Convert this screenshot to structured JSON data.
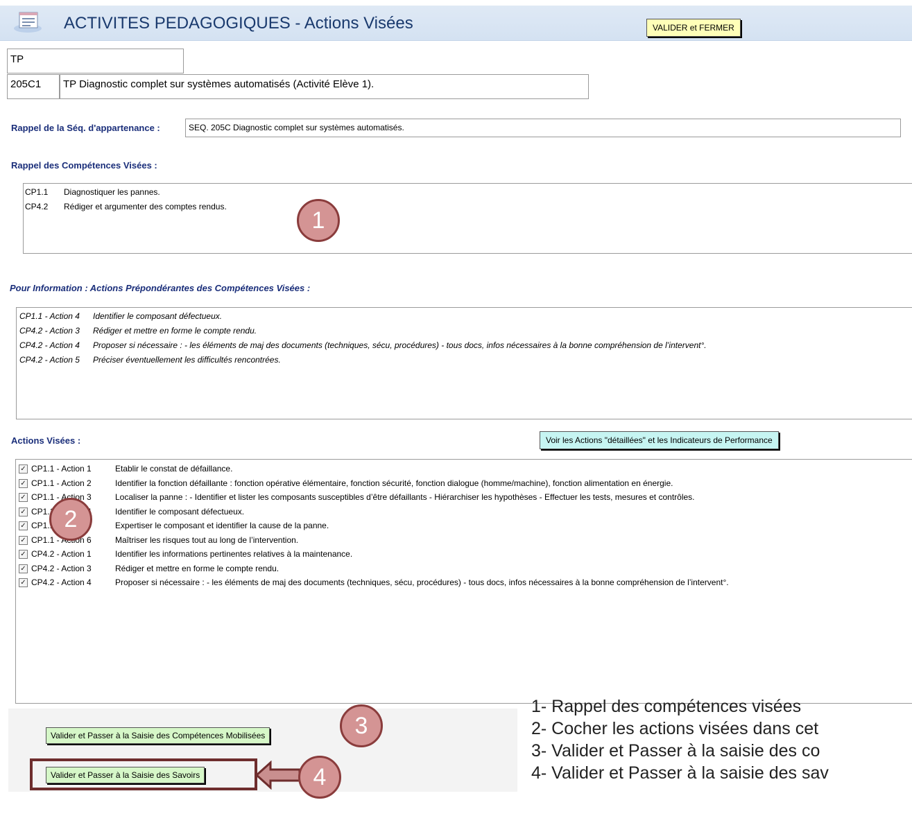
{
  "header": {
    "title": "ACTIVITES PEDAGOGIQUES - Actions Visées",
    "valider_fermer": "VALIDER et FERMER"
  },
  "activity": {
    "type": "TP",
    "code": "205C1",
    "name": "TP Diagnostic complet sur systèmes automatisés  (Activité Elève 1)."
  },
  "sequence": {
    "label": "Rappel de la Séq. d'appartenance :",
    "value": "SEQ. 205C   Diagnostic complet sur systèmes automatisés."
  },
  "competences": {
    "label": "Rappel des Compétences Visées :",
    "items": [
      {
        "code": "CP1.1",
        "desc": "Diagnostiquer les pannes."
      },
      {
        "code": "CP4.2",
        "desc": "Rédiger et argumenter des comptes rendus."
      }
    ]
  },
  "predominant": {
    "label": "Pour Information : Actions Prépondérantes des Compétences Visées :",
    "items": [
      {
        "code": "CP1.1 - Action 4",
        "desc": "Identifier le composant défectueux."
      },
      {
        "code": "CP4.2 - Action 3",
        "desc": "Rédiger et mettre en forme le compte rendu."
      },
      {
        "code": "CP4.2 - Action 4",
        "desc": "Proposer si nécessaire : - les éléments de maj des documents (techniques, sécu, procédures) - tous docs, infos nécessaires à la bonne compréhension de l’intervent°."
      },
      {
        "code": "CP4.2 - Action 5",
        "desc": "Préciser éventuellement les difficultés rencontrées."
      }
    ]
  },
  "actions": {
    "label": "Actions Visées :",
    "detail_button": "Voir les Actions \"détaillées\" et les Indicateurs de Performance",
    "items": [
      {
        "code": "CP1.1 - Action 1",
        "desc": "Etablir le constat de défaillance.",
        "checked": true
      },
      {
        "code": "CP1.1 - Action 2",
        "desc": "Identifier la fonction défaillante : fonction opérative élémentaire, fonction sécurité, fonction dialogue (homme/machine), fonction alimentation en énergie.",
        "checked": true
      },
      {
        "code": "CP1.1 - Action 3",
        "desc": "Localiser la panne : - Identifier et lister les composants susceptibles d’être défaillants - Hiérarchiser les hypothèses - Effectuer les tests, mesures et contrôles.",
        "checked": true
      },
      {
        "code": "CP1.1 - Action 4",
        "desc": "Identifier le composant défectueux.",
        "checked": true
      },
      {
        "code": "CP1.1 - Action 5",
        "desc": "Expertiser le composant et identifier la cause de la panne.",
        "checked": true
      },
      {
        "code": "CP1.1 - Action 6",
        "desc": "Maîtriser les risques tout au long de l’intervention.",
        "checked": true
      },
      {
        "code": "CP4.2 - Action 1",
        "desc": "Identifier les informations pertinentes relatives à la maintenance.",
        "checked": true
      },
      {
        "code": "CP4.2 - Action 3",
        "desc": "Rédiger et mettre en forme le compte rendu.",
        "checked": true
      },
      {
        "code": "CP4.2 - Action 4",
        "desc": "Proposer si nécessaire : - les éléments de maj des documents (techniques, sécu, procédures) - tous docs, infos nécessaires à la bonne compréhension de l’intervent°.",
        "checked": true
      }
    ]
  },
  "buttons": {
    "competences_mobilisees": "Valider et Passer à la Saisie des Compétences Mobilisées",
    "savoirs": "Valider et Passer à la Saisie des Savoirs"
  },
  "badges": [
    "1",
    "2",
    "3",
    "4"
  ],
  "legend": [
    "1- Rappel des compétences visées",
    "2- Cocher les actions visées dans cet",
    "3- Valider et Passer à la saisie des co",
    "4- Valider et Passer à la saisie des sav"
  ],
  "colors": {
    "badge_fill": "#d49494",
    "badge_border": "#8a3c3c",
    "arrow": "#6e2d2d"
  }
}
